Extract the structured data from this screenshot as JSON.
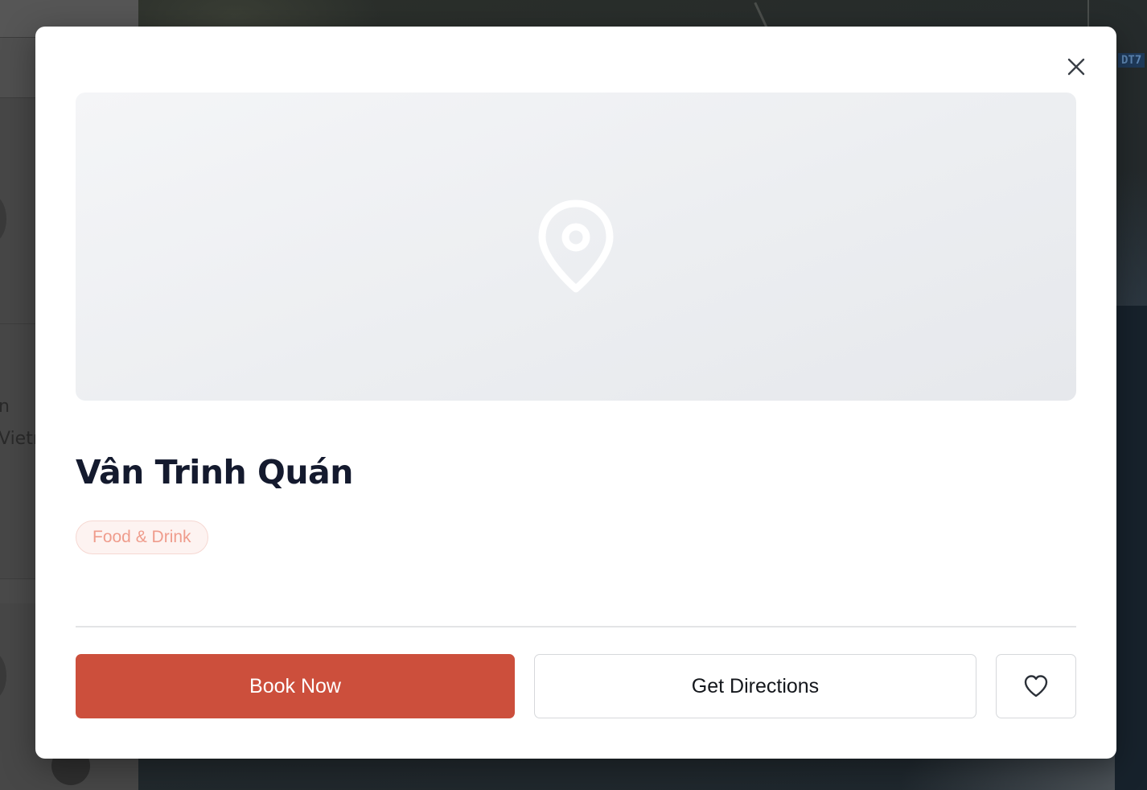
{
  "background": {
    "sidebar_text_lines": [
      "n",
      "Vietr"
    ],
    "map_label": "DT7"
  },
  "modal": {
    "close_icon": "close-icon",
    "hero_icon": "map-pin-icon",
    "title": "Vân Trinh Quán",
    "category": "Food & Drink",
    "actions": {
      "book_label": "Book Now",
      "directions_label": "Get Directions",
      "favorite_icon": "heart-icon"
    }
  },
  "colors": {
    "accent": "#cc4f3c",
    "title": "#141a2e",
    "badge_text": "#ef9c8c",
    "badge_bg": "#fdf3f1"
  }
}
